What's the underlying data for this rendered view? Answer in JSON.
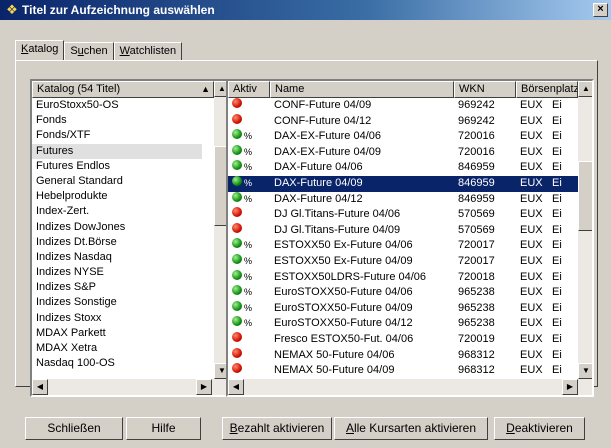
{
  "window": {
    "title": "Titel zur Aufzeichnung auswählen",
    "close_glyph": "×"
  },
  "tabs": [
    {
      "pre": "",
      "u": "K",
      "post": "atalog"
    },
    {
      "pre": "S",
      "u": "u",
      "post": "chen"
    },
    {
      "pre": "",
      "u": "W",
      "post": "atchlisten"
    }
  ],
  "catalog": {
    "header": "Katalog (54 Titel)",
    "items": [
      "EuroStoxx50-OS",
      "Fonds",
      "Fonds/XTF",
      "Futures",
      "Futures Endlos",
      "General Standard",
      "Hebelprodukte",
      "Index-Zert.",
      "Indizes DowJones",
      "Indizes Dt.Börse",
      "Indizes Nasdaq",
      "Indizes NYSE",
      "Indizes S&P",
      "Indizes Sonstige",
      "Indizes Stoxx",
      "MDAX Parkett",
      "MDAX Xetra",
      "Nasdaq 100-OS"
    ],
    "selected_index": 3
  },
  "titles": {
    "columns": [
      "Aktiv",
      "Name",
      "WKN",
      "Börsenplatz"
    ],
    "rows": [
      {
        "status": "red",
        "icon": "",
        "name": "CONF-Future 04/09",
        "wkn": "969242",
        "exch": "EUX",
        "tail": "Ei"
      },
      {
        "status": "red",
        "icon": "",
        "name": "CONF-Future 04/12",
        "wkn": "969242",
        "exch": "EUX",
        "tail": "Ei"
      },
      {
        "status": "green",
        "icon": "%",
        "name": "DAX-EX-Future 04/06",
        "wkn": "720016",
        "exch": "EUX",
        "tail": "Ei"
      },
      {
        "status": "green",
        "icon": "%",
        "name": "DAX-EX-Future 04/09",
        "wkn": "720016",
        "exch": "EUX",
        "tail": "Ei"
      },
      {
        "status": "green",
        "icon": "%",
        "name": "DAX-Future 04/06",
        "wkn": "846959",
        "exch": "EUX",
        "tail": "Ei"
      },
      {
        "status": "green",
        "icon": "%",
        "name": "DAX-Future 04/09",
        "wkn": "846959",
        "exch": "EUX",
        "tail": "Ei"
      },
      {
        "status": "green",
        "icon": "%",
        "name": "DAX-Future 04/12",
        "wkn": "846959",
        "exch": "EUX",
        "tail": "Ei"
      },
      {
        "status": "red",
        "icon": "",
        "name": "DJ Gl.Titans-Future 04/06",
        "wkn": "570569",
        "exch": "EUX",
        "tail": "Ei"
      },
      {
        "status": "red",
        "icon": "",
        "name": "DJ Gl.Titans-Future 04/09",
        "wkn": "570569",
        "exch": "EUX",
        "tail": "Ei"
      },
      {
        "status": "green",
        "icon": "%",
        "name": "ESTOXX50 Ex-Future 04/06",
        "wkn": "720017",
        "exch": "EUX",
        "tail": "Ei"
      },
      {
        "status": "green",
        "icon": "%",
        "name": "ESTOXX50 Ex-Future 04/09",
        "wkn": "720017",
        "exch": "EUX",
        "tail": "Ei"
      },
      {
        "status": "green",
        "icon": "%",
        "name": "ESTOXX50LDRS-Future 04/06",
        "wkn": "720018",
        "exch": "EUX",
        "tail": "Ei"
      },
      {
        "status": "green",
        "icon": "%",
        "name": "EuroSTOXX50-Future 04/06",
        "wkn": "965238",
        "exch": "EUX",
        "tail": "Ei"
      },
      {
        "status": "green",
        "icon": "%",
        "name": "EuroSTOXX50-Future 04/09",
        "wkn": "965238",
        "exch": "EUX",
        "tail": "Ei"
      },
      {
        "status": "green",
        "icon": "%",
        "name": "EuroSTOXX50-Future 04/12",
        "wkn": "965238",
        "exch": "EUX",
        "tail": "Ei"
      },
      {
        "status": "red",
        "icon": "",
        "name": "Fresco ESTOX50-Fut. 04/06",
        "wkn": "720019",
        "exch": "EUX",
        "tail": "Ei"
      },
      {
        "status": "red",
        "icon": "",
        "name": "NEMAX 50-Future 04/06",
        "wkn": "968312",
        "exch": "EUX",
        "tail": "Ei"
      },
      {
        "status": "red",
        "icon": "",
        "name": "NEMAX 50-Future 04/09",
        "wkn": "968312",
        "exch": "EUX",
        "tail": "Ei"
      }
    ],
    "selected_index": 5
  },
  "buttons": {
    "close": "Schließen",
    "help": "Hilfe",
    "paid_pre": "",
    "paid_u": "B",
    "paid_post": "ezahlt aktivieren",
    "all_pre": "",
    "all_u": "A",
    "all_post": "lle Kursarten aktivieren",
    "deact_pre": "",
    "deact_u": "D",
    "deact_post": "eaktivieren"
  },
  "icons": {
    "app": "app-icon",
    "close": "close-icon",
    "status_red": "red-status-icon",
    "status_green": "green-status-icon",
    "future": "future-icon"
  },
  "colors": {
    "title_bar": "#0a246a",
    "selection": "#0a246a",
    "face": "#d4d0c8",
    "active_dot": "#109010",
    "inactive_dot": "#d01000"
  }
}
